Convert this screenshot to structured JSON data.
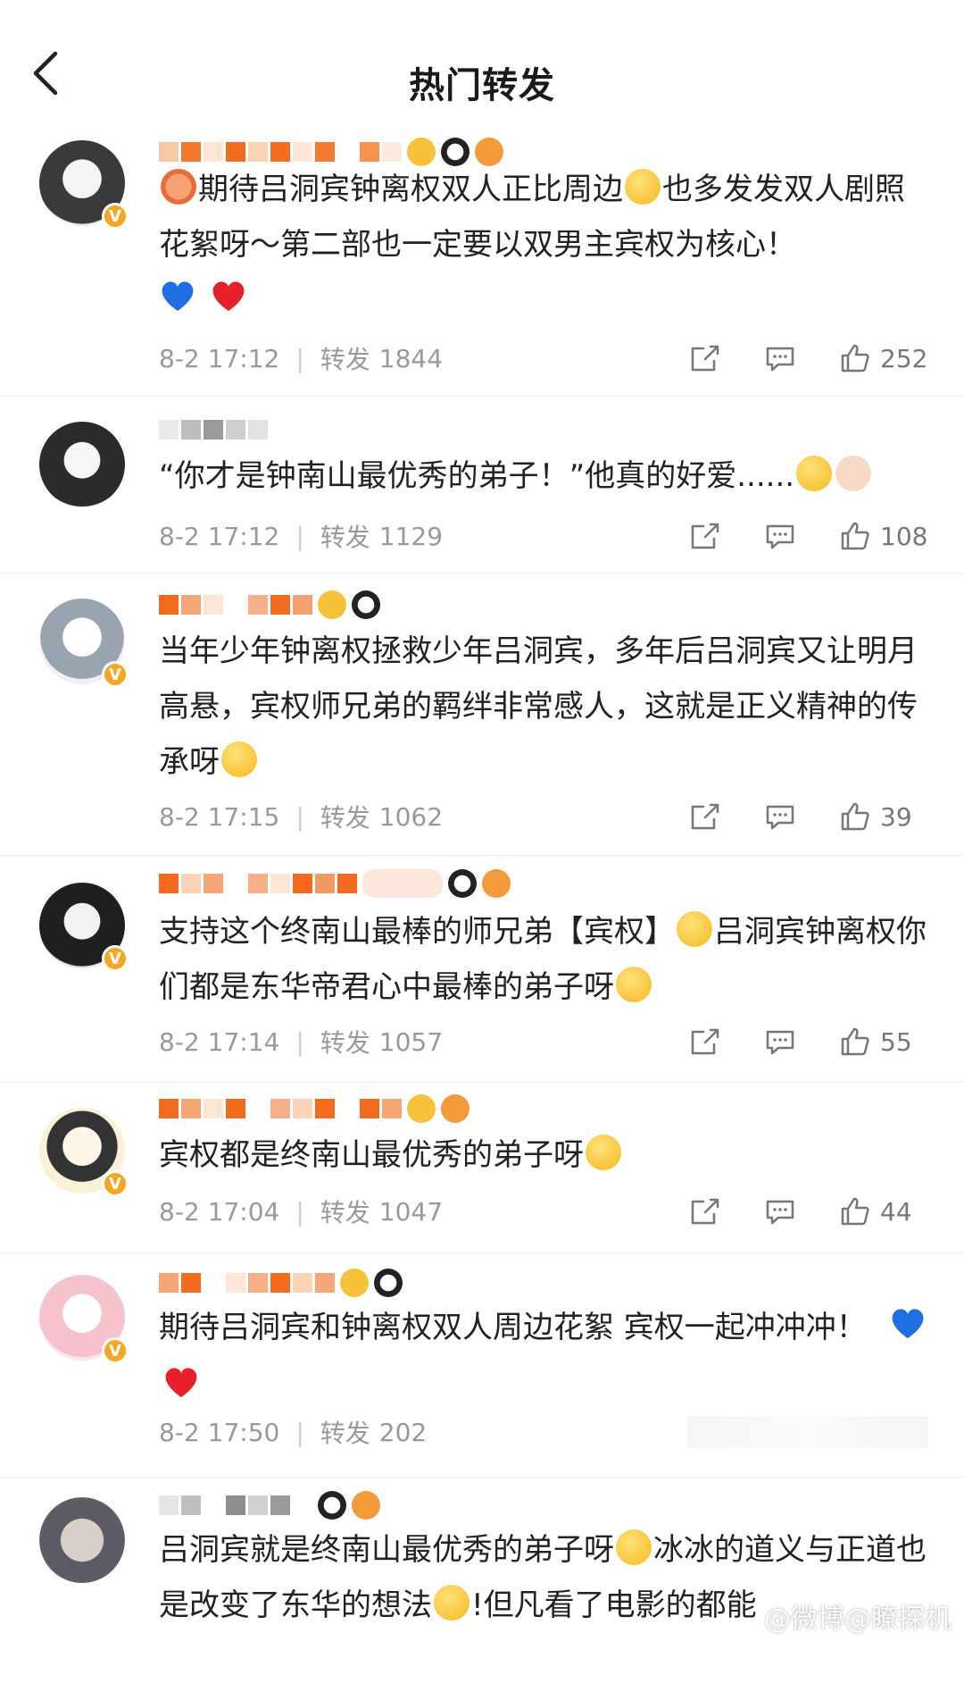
{
  "header": {
    "title": "热门转发"
  },
  "comments": [
    {
      "text_parts": [
        "",
        "期待吕洞宾钟离权双人正比周边",
        "也多发发双人剧照花絮呀～第二部也一定要以双男主宾权为核心！"
      ],
      "date": "8-2 17:12",
      "repost_label": "转发",
      "reposts": "1844",
      "likes": "252"
    },
    {
      "text_parts": [
        "“你才是钟南山最优秀的弟子！”他真的好爱......"
      ],
      "date": "8-2 17:12",
      "repost_label": "转发",
      "reposts": "1129",
      "likes": "108"
    },
    {
      "text_parts": [
        "当年少年钟离权拯救少年吕洞宾，多年后吕洞宾又让明月高悬，宾权师兄弟的羁绊非常感人，这就是正义精神的传承呀"
      ],
      "date": "8-2 17:15",
      "repost_label": "转发",
      "reposts": "1062",
      "likes": "39"
    },
    {
      "text_parts": [
        "支持这个终南山最棒的师兄弟【宾权】",
        "吕洞宾钟离权你们都是东华帝君心中最棒的弟子呀"
      ],
      "date": "8-2 17:14",
      "repost_label": "转发",
      "reposts": "1057",
      "likes": "55"
    },
    {
      "text_parts": [
        "宾权都是终南山最优秀的弟子呀"
      ],
      "date": "8-2 17:04",
      "repost_label": "转发",
      "reposts": "1047",
      "likes": "44"
    },
    {
      "text_parts": [
        "期待吕洞宾和钟离权双人周边花絮 宾权一起冲冲冲！"
      ],
      "date": "8-2 17:50",
      "repost_label": "转发",
      "reposts": "202",
      "likes": ""
    },
    {
      "text_parts": [
        "吕洞宾就是终南山最优秀的弟子呀",
        "冰冰的道义与正道也是改变了东华的想法",
        "!但凡看了电影的都能"
      ],
      "date": "",
      "repost_label": "",
      "reposts": "",
      "likes": ""
    }
  ],
  "watermark": "@微博@瞭探机",
  "colors": {
    "accent": "#f5a623",
    "meta": "#999999",
    "heart_blue": "#1f6fe0",
    "heart_red": "#e8202a"
  }
}
